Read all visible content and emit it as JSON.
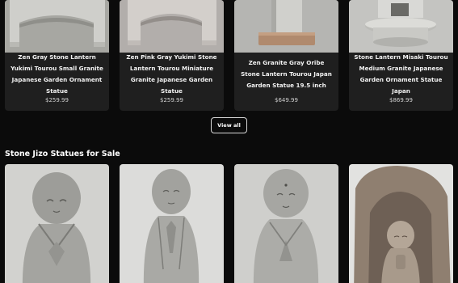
{
  "lanterns": [
    {
      "title": "Zen Gray Stone Lantern Yukimi Tourou Small Granite Japanese Garden Ornament Statue",
      "price": "$259.99"
    },
    {
      "title": "Zen Pink Gray Yukimi Stone Lantern Tourou Miniature Granite Japanese Garden Statue",
      "price": "$259.99"
    },
    {
      "title": "Zen Granite Gray Oribe Stone Lantern Tourou Japan Garden Statue 19.5 inch",
      "price": "$649.99"
    },
    {
      "title": "Stone Lantern Misaki Tourou Medium Granite Japanese Garden Ornament Statue Japan",
      "price": "$869.99"
    }
  ],
  "view_all_label": "View all",
  "jizo_section": {
    "title": "Stone Jizo Statues for Sale"
  },
  "colors": {
    "background": "#0b0b0b",
    "card": "#1f1f1f",
    "price": "#cfcfcf"
  }
}
